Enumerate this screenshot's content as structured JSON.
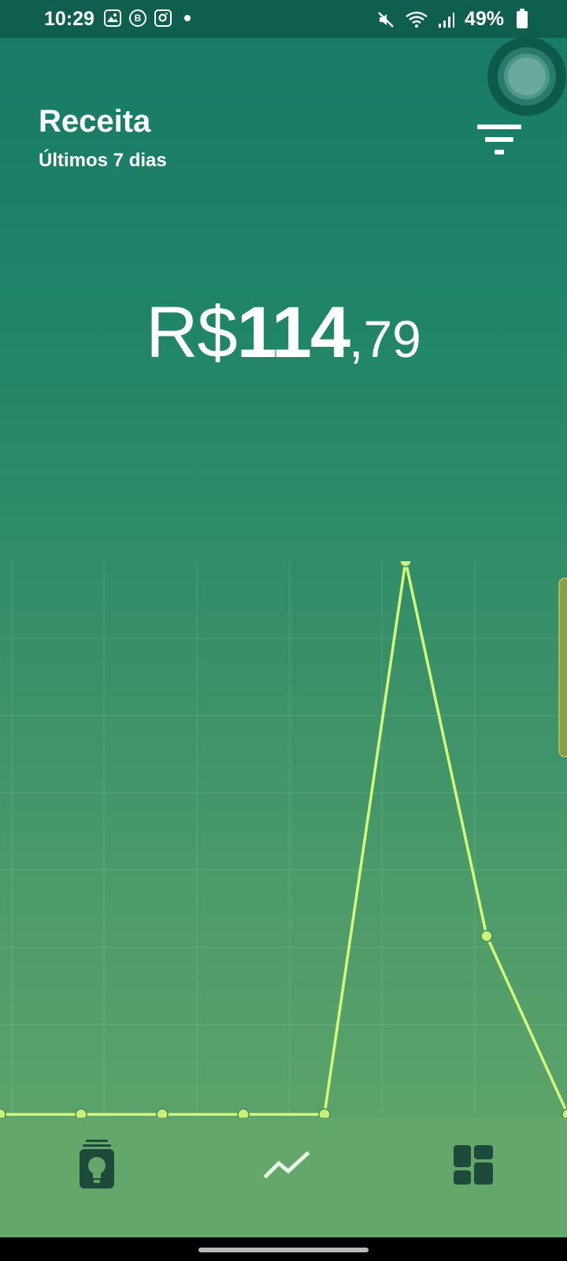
{
  "status_bar": {
    "time": "10:29",
    "battery": "49%",
    "icons_left": [
      "gallery-icon",
      "b-app-icon",
      "instagram-icon",
      "dot-icon"
    ],
    "icons_right": [
      "mute-icon",
      "wifi-icon",
      "signal-icon",
      "battery-icon"
    ]
  },
  "header": {
    "title": "Receita",
    "subtitle": "Últimos 7 dias",
    "filter_icon": "filter-icon"
  },
  "total": {
    "currency": "R$",
    "integer": "114",
    "decimal": ",79"
  },
  "chart_data": {
    "type": "line",
    "x": [
      1,
      2,
      3,
      4,
      5,
      6,
      7,
      8
    ],
    "series": [
      {
        "values": [
          0,
          0,
          0,
          0,
          0,
          114.79,
          37,
          0
        ]
      }
    ],
    "ylim": [
      0,
      114.79
    ],
    "grid": true,
    "colors": {
      "line": "#d4fa7a",
      "point_fill": "#c8f07a",
      "grid": "#ffffff"
    }
  },
  "bottom_nav": {
    "items": [
      {
        "icon": "lightbulb-card-icon"
      },
      {
        "icon": "trend-line-icon"
      },
      {
        "icon": "dashboard-grid-icon"
      }
    ]
  },
  "colors": {
    "statusbar": "#0f5f4f",
    "nav_background": "#63a76b",
    "dark_icon": "#1d4a3a",
    "accent_line": "#d4fa7a"
  }
}
